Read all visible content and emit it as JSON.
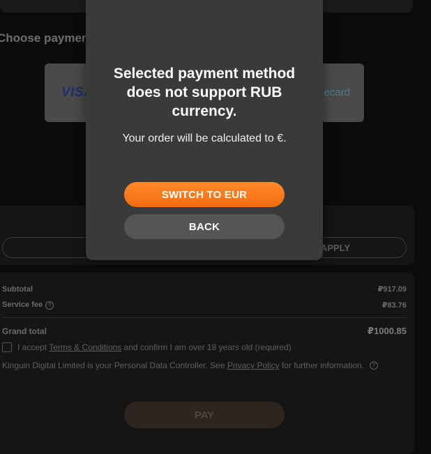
{
  "background": {
    "section_title": "Choose payment",
    "payment_methods": [
      {
        "label": "VISA",
        "icon": "visa-logo"
      },
      {
        "label": "ecard",
        "icon": "ecard-logo"
      }
    ],
    "coupon": {
      "apply_label": "APPLY"
    },
    "summary": {
      "subtotal_label": "Subtotal",
      "subtotal_value": "₽917.09",
      "fee_label": "Service fee",
      "fee_value": "₽83.76",
      "grand_label": "Grand total",
      "grand_value": "₽1000.85"
    },
    "terms": {
      "prefix": "I accept ",
      "link": "Terms & Conditions",
      "suffix": " and confirm I am over 18 years old (required)"
    },
    "controller": {
      "prefix": "Kinguin Digital Limited is your Personal Data Controller. See ",
      "link": "Privacy Policy",
      "suffix": " for further information."
    },
    "pay_label": "PAY"
  },
  "modal": {
    "title": "Selected payment method does not support RUB currency.",
    "body": "Your order will be calculated to €.",
    "switch_label": "SWITCH TO EUR",
    "back_label": "BACK"
  },
  "colors": {
    "accent": "#f57a1c",
    "modal_bg": "#3a3a3a",
    "back_button": "#555555"
  }
}
